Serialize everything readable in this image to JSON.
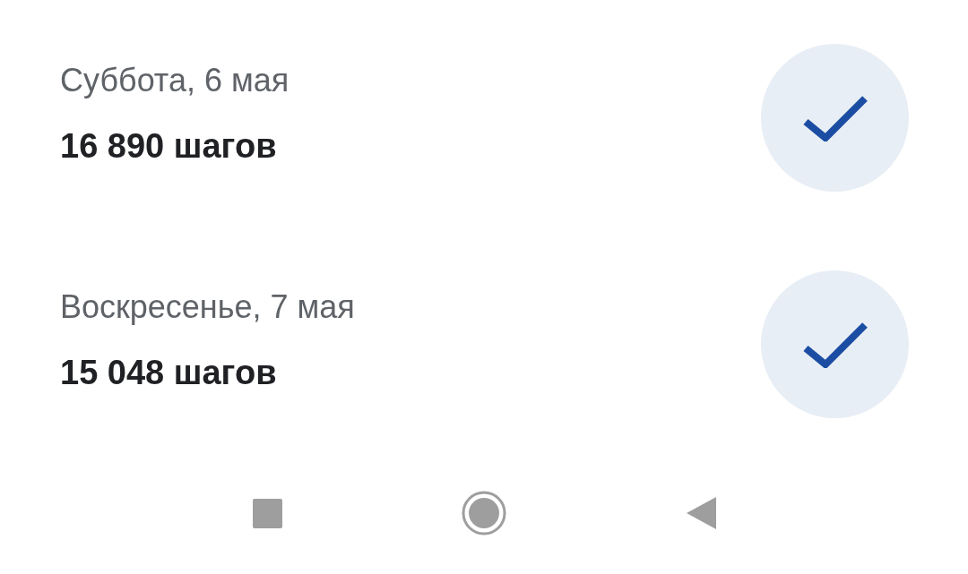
{
  "days": [
    {
      "date": "Суббота, 6 мая",
      "steps": "16 890 шагов",
      "done": true
    },
    {
      "date": "Воскресенье, 7 мая",
      "steps": "15 048 шагов",
      "done": true
    }
  ]
}
